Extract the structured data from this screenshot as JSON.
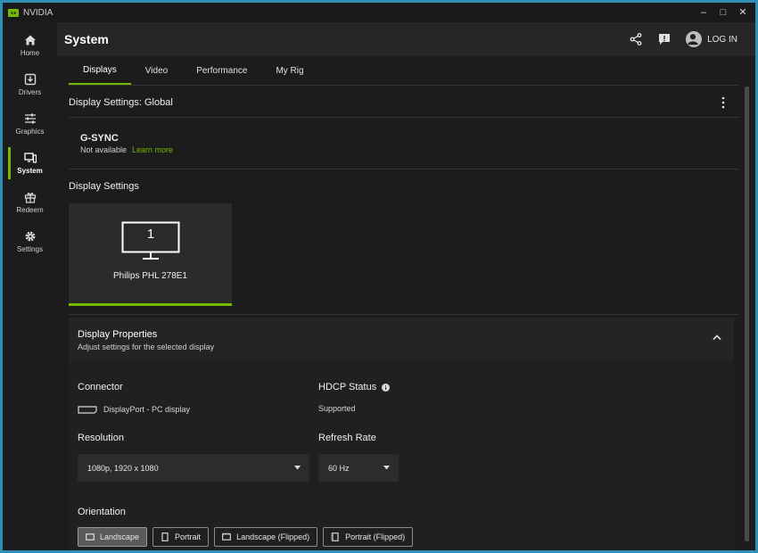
{
  "window": {
    "app_name": "NVIDIA",
    "controls": [
      "–",
      "□",
      "✕"
    ]
  },
  "sidebar": {
    "items": [
      {
        "label": "Home",
        "icon": "home-icon"
      },
      {
        "label": "Drivers",
        "icon": "drivers-icon"
      },
      {
        "label": "Graphics",
        "icon": "sliders-icon"
      },
      {
        "label": "System",
        "icon": "system-icon",
        "active": true
      },
      {
        "label": "Redeem",
        "icon": "gift-icon"
      },
      {
        "label": "Settings",
        "icon": "gear-icon"
      }
    ]
  },
  "header": {
    "title": "System",
    "login_label": "LOG IN"
  },
  "tabs": [
    {
      "label": "Displays",
      "active": true
    },
    {
      "label": "Video"
    },
    {
      "label": "Performance"
    },
    {
      "label": "My Rig"
    }
  ],
  "section": {
    "title": "Display Settings: Global"
  },
  "gsync": {
    "title": "G-SYNC",
    "status": "Not available",
    "link": "Learn more"
  },
  "display_settings": {
    "title": "Display Settings",
    "displays": [
      {
        "number": "1",
        "name": "Philips PHL 278E1",
        "selected": true
      }
    ]
  },
  "display_properties": {
    "title": "Display Properties",
    "subtitle": "Adjust settings for the selected display",
    "connector_label": "Connector",
    "connector_value": "DisplayPort - PC display",
    "hdcp_label": "HDCP Status",
    "hdcp_value": "Supported",
    "resolution_label": "Resolution",
    "resolution_value": "1080p, 1920 x 1080",
    "refresh_label": "Refresh Rate",
    "refresh_value": "60 Hz",
    "orientation_label": "Orientation",
    "orientations": [
      {
        "label": "Landscape",
        "active": true
      },
      {
        "label": "Portrait"
      },
      {
        "label": "Landscape (Flipped)"
      },
      {
        "label": "Portrait (Flipped)"
      }
    ]
  },
  "colors": {
    "accent": "#76b900",
    "background": "#1c1c1c",
    "header": "#262626"
  }
}
